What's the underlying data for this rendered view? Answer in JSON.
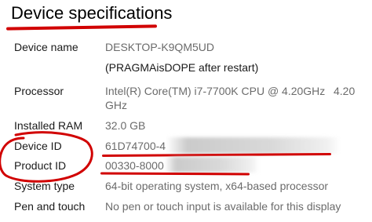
{
  "header": {
    "title": "Device specifications"
  },
  "specs": {
    "device_name": {
      "label": "Device name",
      "value": "DESKTOP-K9QM5UD",
      "note": "(PRAGMAisDOPE after restart)"
    },
    "processor": {
      "label": "Processor",
      "value": "Intel(R) Core(TM) i7-7700K CPU @ 4.20GHz",
      "value_overflow": "4.20",
      "value_wrap": "GHz"
    },
    "installed_ram": {
      "label": "Installed RAM",
      "value": "32.0 GB"
    },
    "device_id": {
      "label": "Device ID",
      "value": "61D74700-4"
    },
    "product_id": {
      "label": "Product ID",
      "value": "00330-8000"
    },
    "system_type": {
      "label": "System type",
      "value": "64-bit operating system, x64-based processor"
    },
    "pen_touch": {
      "label": "Pen and touch",
      "value": "No pen or touch input is available for this display"
    }
  },
  "annotation_colors": {
    "markup": "#d10000"
  }
}
